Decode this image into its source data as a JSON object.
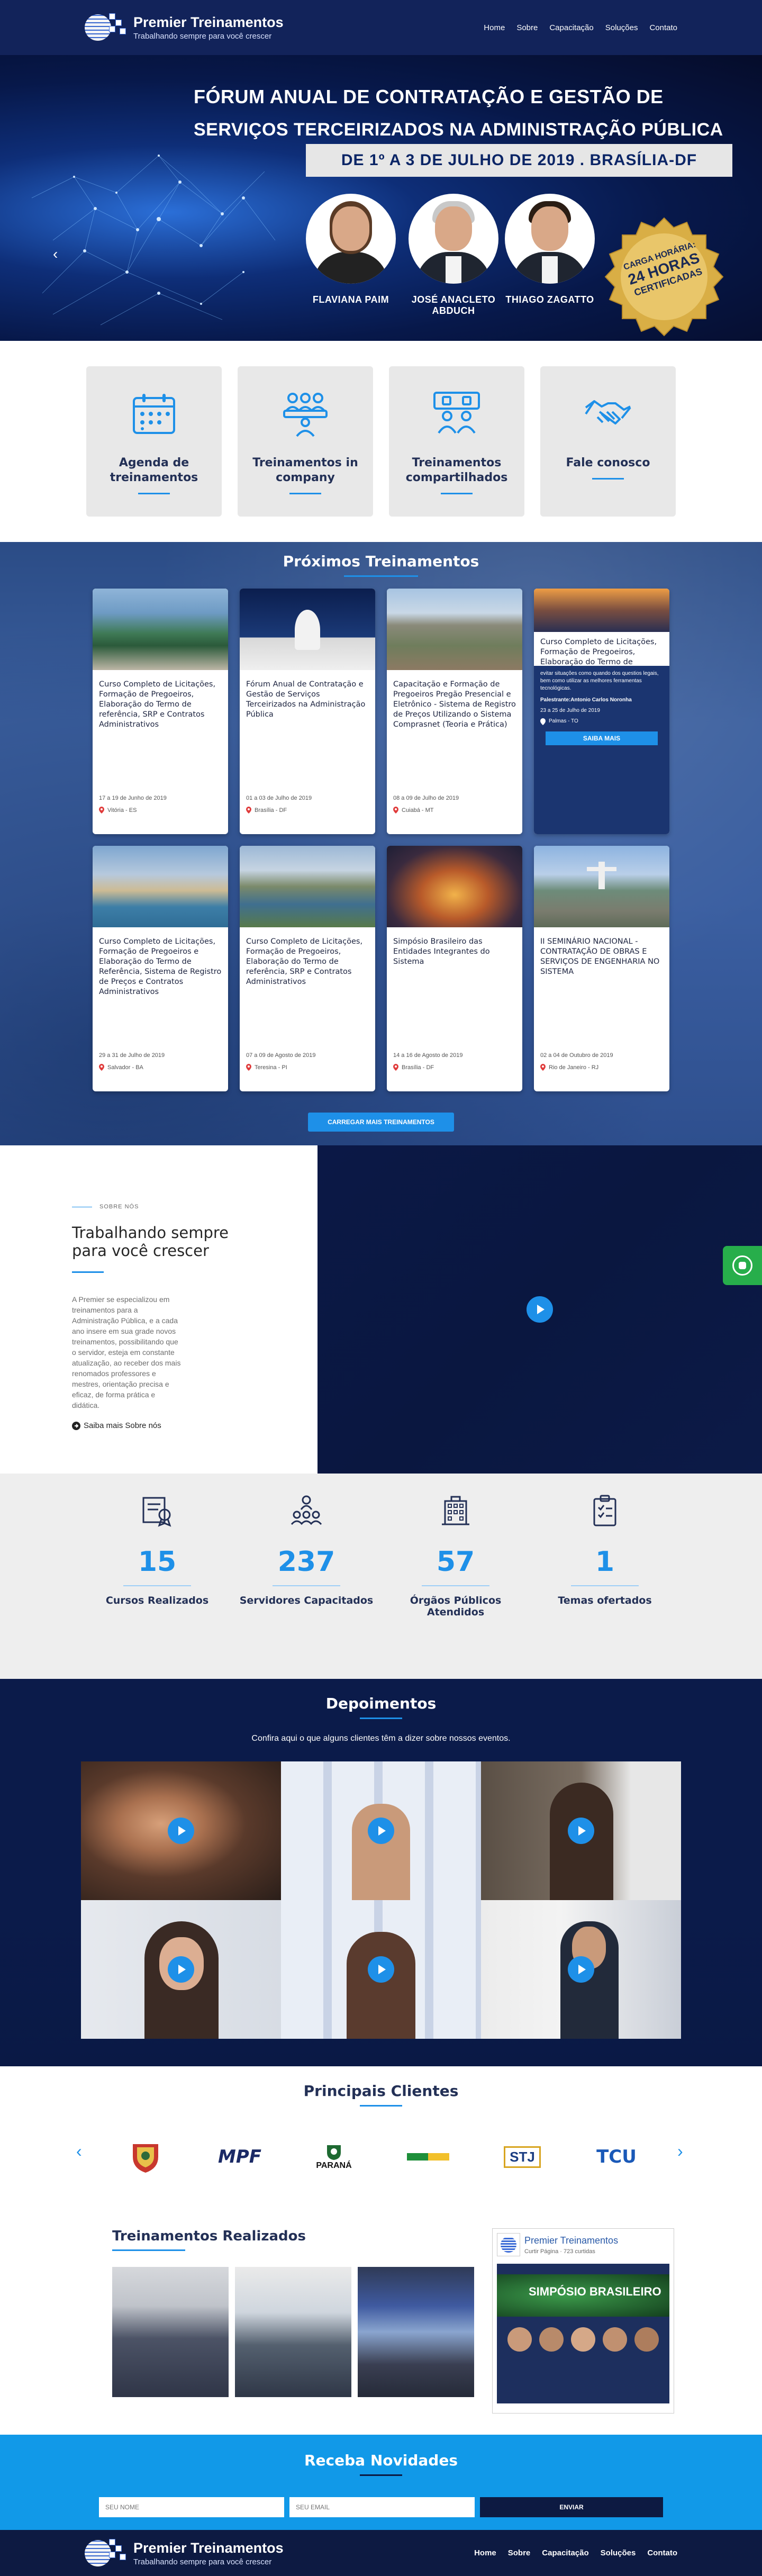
{
  "brand": {
    "name": "Premier Treinamentos",
    "tagline": "Trabalhando sempre para você crescer"
  },
  "nav": [
    "Home",
    "Sobre",
    "Capacitação",
    "Soluções",
    "Contato"
  ],
  "hero": {
    "title_line1": "FÓRUM ANUAL DE CONTRATAÇÃO E GESTÃO DE",
    "title_line2": "SERVIÇOS TERCEIRIZADOS NA ADMINISTRAÇÃO PÚBLICA",
    "date": "DE 1º A 3 DE JULHO DE 2019 . BRASÍLIA-DF",
    "speakers": [
      "FLAVIANA PAIM",
      "JOSÉ ANACLETO ABDUCH",
      "THIAGO ZAGATTO"
    ],
    "seal": {
      "line1": "CARGA HORÁRIA:",
      "line2": "24 HORAS",
      "line3": "CERTIFICADAS"
    }
  },
  "features": [
    {
      "label": "Agenda de treinamentos",
      "icon": "calendar-icon"
    },
    {
      "label": "Treinamentos in company",
      "icon": "team-icon"
    },
    {
      "label": "Treinamentos compartilhados",
      "icon": "group-icon"
    },
    {
      "label": "Fale conosco",
      "icon": "handshake-icon"
    }
  ],
  "proximos": {
    "title": "Próximos Treinamentos",
    "cards": [
      {
        "title": "Curso Completo de Licitações, Formação de Pregoeiros, Elaboração do Termo de referência, SRP e Contratos Administrativos",
        "date": "17 a 19 de Junho de 2019",
        "location": "Vitória - ES"
      },
      {
        "title": "Fórum Anual de Contratação e Gestão de Serviços Terceirizados na Administração Pública",
        "date": "01 a 03 de Julho de 2019",
        "location": "Brasília - DF"
      },
      {
        "title": "Capacitação e Formação de Pregoeiros Pregão Presencial e Eletrônico - Sistema de Registro de Preços Utilizando o Sistema Comprasnet (Teoria e Prática)",
        "date": "08 a 09 de Julho de 2019",
        "location": "Cuiabá - MT"
      },
      {
        "title": "Curso Completo de Licitações, Formação de Pregoeiros, Elaboração do Termo de referência",
        "hover_text": "evitar situações como quando dos questios legais, bem como utilizar as melhores ferramentas tecnológicas.",
        "instructor": "Palestrante:Antonio Carlos Noronha",
        "date": "23 a 25 de Julho de 2019",
        "location": "Palmas - TO",
        "button": "SAIBA MAIS"
      },
      {
        "title": "Curso Completo de Licitações, Formação de Pregoeiros e Elaboração do Termo de Referência, Sistema de Registro de Preços e Contratos Administrativos",
        "date": "29 a 31 de Julho de 2019",
        "location": "Salvador - BA"
      },
      {
        "title": "Curso Completo de Licitações, Formação de Pregoeiros, Elaboração do Termo de referência, SRP e Contratos Administrativos",
        "date": "07 a 09 de Agosto de 2019",
        "location": "Teresina - PI"
      },
      {
        "title": "Simpósio Brasileiro das Entidades Integrantes do Sistema",
        "date": "14 a 16 de Agosto de 2019",
        "location": "Brasília - DF"
      },
      {
        "title": "II SEMINÁRIO NACIONAL - CONTRATAÇÃO DE OBRAS E SERVIÇOS DE ENGENHARIA NO SISTEMA",
        "date": "02 a 04 de Outubro de 2019",
        "location": "Rio de Janeiro - RJ"
      }
    ],
    "load_more": "CARREGAR MAIS TREINAMENTOS"
  },
  "sobre": {
    "kicker": "SOBRE NÓS",
    "title": "Trabalhando sempre para você crescer",
    "text": "A Premier se especializou em treinamentos para a Administração Pública, e a cada ano insere em sua grade novos treinamentos, possibilitando que o servidor, esteja em constante atualização, ao receber dos mais renomados professores e mestres, orientação precisa e eficaz, de forma prática e didática.",
    "link": "Saiba mais Sobre nós"
  },
  "stats": [
    {
      "value": "15",
      "label": "Cursos Realizados",
      "icon": "certificate-icon"
    },
    {
      "value": "237",
      "label": "Servidores Capacitados",
      "icon": "people-icon"
    },
    {
      "value": "57",
      "label": "Órgãos Públicos Atendidos",
      "icon": "building-icon"
    },
    {
      "value": "1",
      "label": "Temas ofertados",
      "icon": "clipboard-icon"
    }
  ],
  "depoimentos": {
    "title": "Depoimentos",
    "subtitle": "Confira aqui o que alguns clientes têm a dizer sobre nossos eventos."
  },
  "clientes": {
    "title": "Principais Clientes",
    "logos": [
      "MPF",
      "PARANÁ",
      "STJ",
      "TCU"
    ]
  },
  "realizados": {
    "title": "Treinamentos Realizados"
  },
  "facebook": {
    "page_name": "Premier Treinamentos",
    "meta": "Curtir Página · 723 curtidas",
    "post_title": "SIMPÓSIO BRASILEIRO"
  },
  "newsletter": {
    "title": "Receba Novidades",
    "name_placeholder": "SEU NOME",
    "email_placeholder": "SEU EMAIL",
    "button": "ENVIAR"
  },
  "colors": {
    "navy": "#12235a",
    "accent": "#1e90e8",
    "dark": "#0d1a42"
  }
}
